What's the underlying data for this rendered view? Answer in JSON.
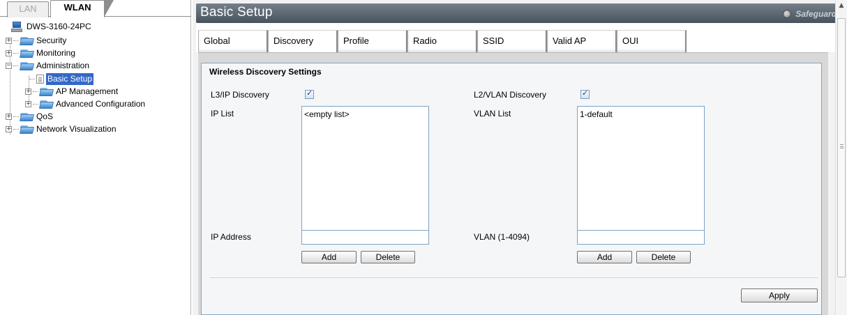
{
  "top_tabs": {
    "lan": "LAN",
    "wlan": "WLAN"
  },
  "tree": {
    "device": "DWS-3160-24PC",
    "security": "Security",
    "monitoring": "Monitoring",
    "administration": "Administration",
    "basic_setup": "Basic Setup",
    "ap_management": "AP Management",
    "advanced_configuration": "Advanced Configuration",
    "qos": "QoS",
    "network_visualization": "Network Visualization",
    "expand_symbol": "+",
    "collapse_symbol": "−"
  },
  "header": {
    "title": "Basic Setup",
    "safeguard": "Safeguard"
  },
  "tabs": [
    "Global",
    "Discovery",
    "Profile",
    "Radio",
    "SSID",
    "Valid AP",
    "OUI"
  ],
  "active_tab": "Discovery",
  "discovery": {
    "section_title": "Wireless Discovery Settings",
    "l3_label": "L3/IP Discovery",
    "l3_checked": true,
    "l2_label": "L2/VLAN Discovery",
    "l2_checked": true,
    "ip_list_label": "IP List",
    "ip_list_items": [
      "<empty list>"
    ],
    "vlan_list_label": "VLAN List",
    "vlan_list_items": [
      "1-default"
    ],
    "ip_address_label": "IP Address",
    "ip_address_value": "",
    "vlan_label": "VLAN (1-4094)",
    "vlan_value": "",
    "add_label": "Add",
    "delete_label": "Delete",
    "apply_label": "Apply"
  },
  "scrollbar": {
    "up_arrow": "▲"
  }
}
